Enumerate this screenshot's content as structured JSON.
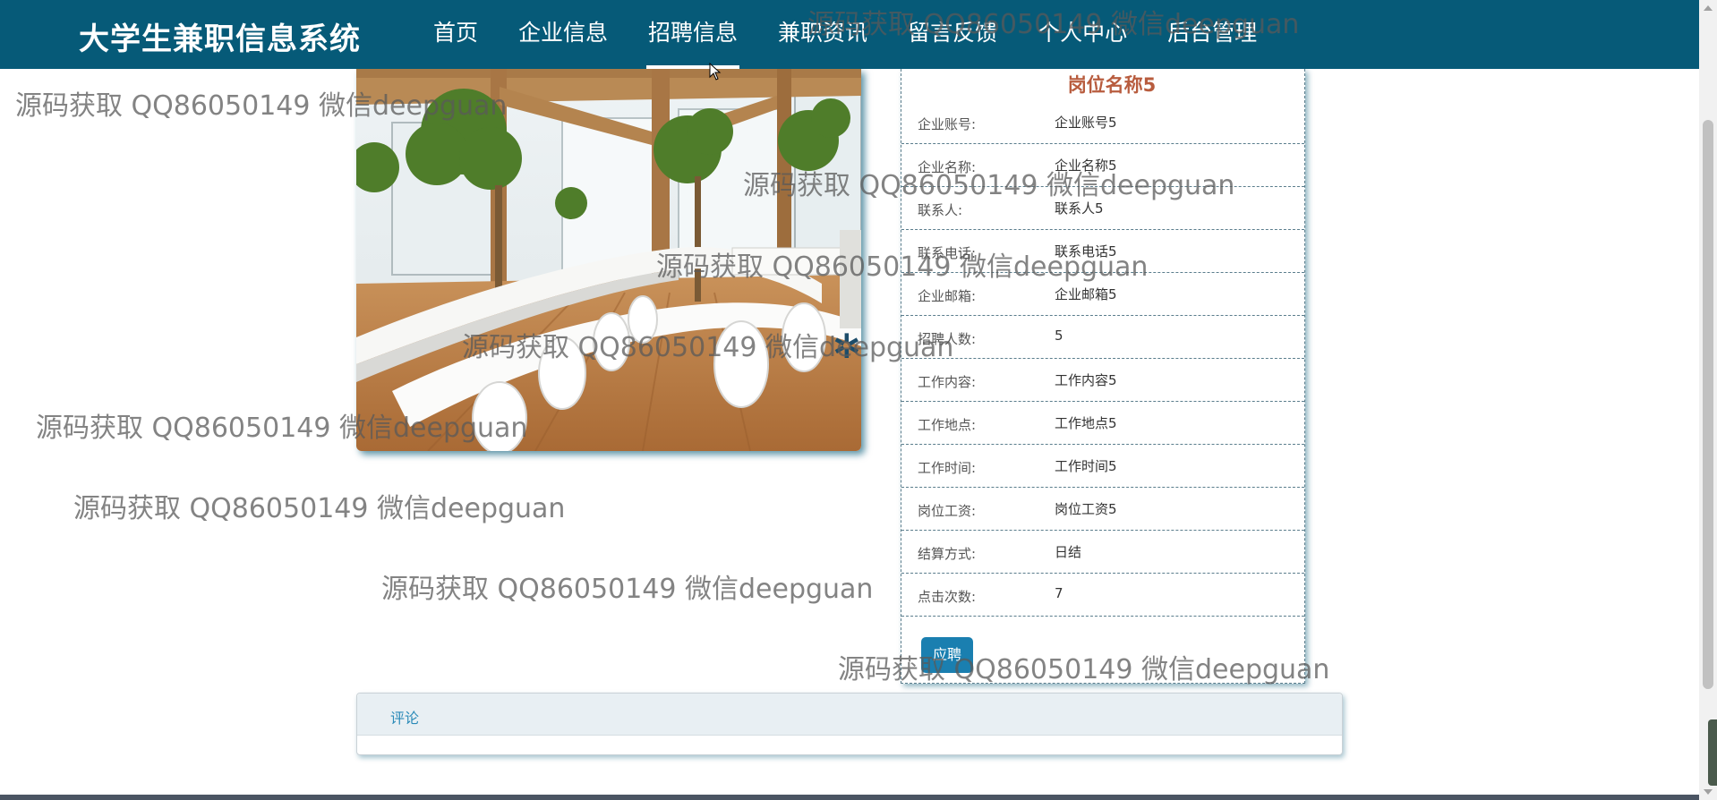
{
  "header": {
    "brand": "大学生兼职信息系统",
    "nav": [
      {
        "label": "首页"
      },
      {
        "label": "企业信息"
      },
      {
        "label": "招聘信息",
        "active": true
      },
      {
        "label": "兼职资讯"
      },
      {
        "label": "留言反馈"
      },
      {
        "label": "个人中心"
      },
      {
        "label": "后台管理"
      }
    ]
  },
  "detail": {
    "title": "岗位名称5",
    "fields": [
      {
        "label": "企业账号:",
        "value": "企业账号5"
      },
      {
        "label": "企业名称:",
        "value": "企业名称5"
      },
      {
        "label": "联系人:",
        "value": "联系人5"
      },
      {
        "label": "联系电话:",
        "value": "联系电话5"
      },
      {
        "label": "企业邮箱:",
        "value": "企业邮箱5"
      },
      {
        "label": "招聘人数:",
        "value": "5"
      },
      {
        "label": "工作内容:",
        "value": "工作内容5"
      },
      {
        "label": "工作地点:",
        "value": "工作地点5"
      },
      {
        "label": "工作时间:",
        "value": "工作时间5"
      },
      {
        "label": "岗位工资:",
        "value": "岗位工资5"
      },
      {
        "label": "结算方式:",
        "value": "日结"
      },
      {
        "label": "点击次数:",
        "value": "7"
      }
    ],
    "apply_label": "应聘"
  },
  "comment": {
    "title": "评论"
  },
  "watermark": {
    "text": "源码获取 QQ86050149 微信deepguan"
  },
  "colors": {
    "header_bg": "#065a78",
    "title_accent": "#b85c3e",
    "button_bg": "#1a7fb0",
    "link_blue": "#2a8ab8"
  },
  "icons": {
    "loading": "loading-spinner-icon",
    "cursor": "mouse-cursor-icon"
  }
}
